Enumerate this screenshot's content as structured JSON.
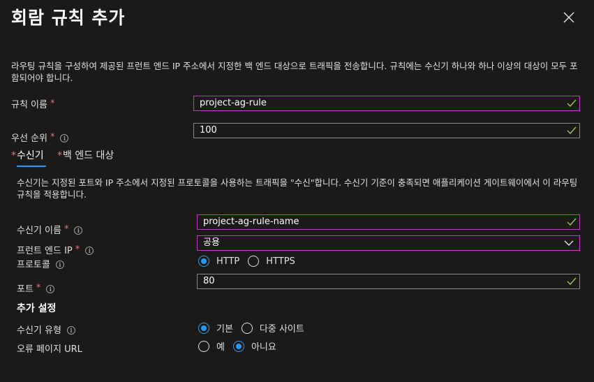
{
  "dialog": {
    "title": "회람 규칙 추가",
    "description": "라우팅 규칙을 구성하여 제공된 프런트 엔드 IP 주소에서 지정한 백 엔드 대상으로 트래픽을 전송합니다. 규칙에는 수신기 하나와 하나 이상의 대상이 모두 포함되어야 합니다."
  },
  "rule": {
    "name_label": "규칙 이름",
    "name_value": "project-ag-rule",
    "priority_label": "우선 순위",
    "priority_value": "100"
  },
  "tabs": [
    {
      "label": "수신기",
      "active": true
    },
    {
      "label": "백 엔드 대상",
      "active": false
    }
  ],
  "listener": {
    "description": "수신기는 지정된 포트와 IP 주소에서 지정된 프로토콜을 사용하는 트래픽을 \"수신\"합니다. 수신기 기준이 충족되면 애플리케이션 게이트웨이에서 이 라우팅 규칙을 적용합니다.",
    "name_label": "수신기 이름",
    "name_value": "project-ag-rule-name",
    "frontend_ip_label": "프런트 엔드 IP",
    "frontend_ip_value": "공용",
    "protocol_label": "프로토콜",
    "protocol_options": [
      "HTTP",
      "HTTPS"
    ],
    "protocol_selected": "HTTP",
    "port_label": "포트",
    "port_value": "80"
  },
  "additional": {
    "section_title": "추가 설정",
    "listener_type_label": "수신기 유형",
    "listener_type_options": [
      "기본",
      "다중 사이트"
    ],
    "listener_type_selected": "기본",
    "error_page_label": "오류 페이지 URL",
    "error_page_options": [
      "예",
      "아니요"
    ],
    "error_page_selected": "아니요"
  },
  "required_marker": "*",
  "info_glyph": "i",
  "colors": {
    "background": "#1b1a19",
    "accent": "#2899f5",
    "input_border": "#c239c7",
    "valid_check": "#92c353",
    "required": "#f1707b"
  }
}
